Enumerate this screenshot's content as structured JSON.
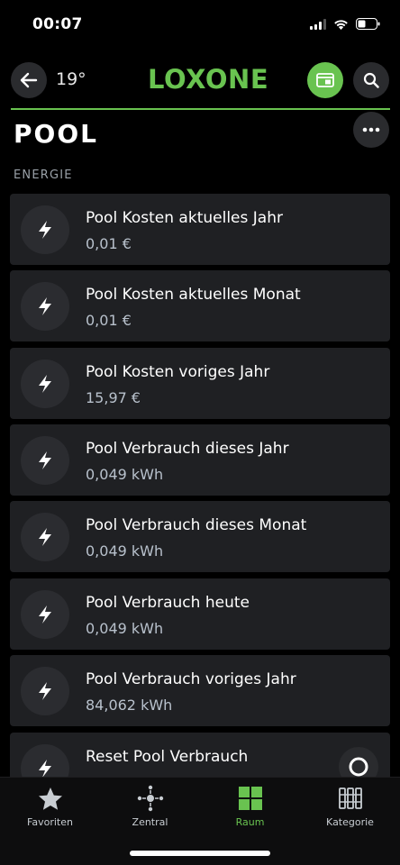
{
  "status": {
    "time": "00:07"
  },
  "header": {
    "temperature": "19°",
    "logo": "LOXONE"
  },
  "page": {
    "title": "POOL",
    "section": "ENERGIE"
  },
  "items": [
    {
      "title": "Pool Kosten aktuelles Jahr",
      "value": "0,01 €",
      "icon": "lightning-icon"
    },
    {
      "title": "Pool Kosten aktuelles Monat",
      "value": "0,01 €",
      "icon": "lightning-icon"
    },
    {
      "title": "Pool Kosten voriges Jahr",
      "value": "15,97 €",
      "icon": "lightning-icon"
    },
    {
      "title": "Pool Verbrauch dieses Jahr",
      "value": "0,049 kWh",
      "icon": "lightning-icon"
    },
    {
      "title": "Pool Verbrauch dieses Monat",
      "value": "0,049 kWh",
      "icon": "lightning-icon"
    },
    {
      "title": "Pool Verbrauch heute",
      "value": "0,049 kWh",
      "icon": "lightning-icon"
    },
    {
      "title": "Pool Verbrauch voriges Jahr",
      "value": "84,062 kWh",
      "icon": "lightning-icon"
    },
    {
      "title": "Reset Pool Verbrauch",
      "value": "",
      "icon": "lightning-icon"
    }
  ],
  "tabs": [
    {
      "label": "Favoriten",
      "icon": "star-icon",
      "active": false
    },
    {
      "label": "Zentral",
      "icon": "hub-icon",
      "active": false
    },
    {
      "label": "Raum",
      "icon": "grid-icon",
      "active": true
    },
    {
      "label": "Kategorie",
      "icon": "columns-icon",
      "active": false
    }
  ],
  "colors": {
    "accent": "#69c350",
    "background": "#000000",
    "card": "#1f2023"
  }
}
